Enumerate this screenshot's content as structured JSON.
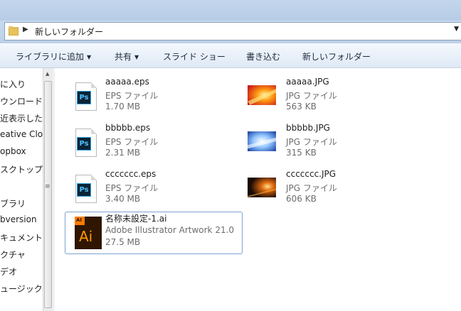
{
  "address": {
    "crumb": "新しいフォルダー"
  },
  "toolbar": {
    "library": "ライブラリに追加",
    "share": "共有",
    "slideshow": "スライド ショー",
    "burn": "書き込む",
    "new_folder": "新しいフォルダー"
  },
  "nav": {
    "items": [
      "に入り",
      "ウンロード",
      "近表示した",
      "eative Clo",
      "opbox",
      "スクトップ",
      "ブラリ",
      "bversion",
      "キュメント",
      "クチャ",
      "デオ",
      "ュージック"
    ]
  },
  "files": [
    {
      "name": "aaaaa.eps",
      "type": "EPS ファイル",
      "size": "1.70 MB",
      "icon": "photoshop-eps-icon",
      "badge": "Ps"
    },
    {
      "name": "aaaaa.JPG",
      "type": "JPG ファイル",
      "size": "563 KB",
      "icon": "jpg-thumbnail"
    },
    {
      "name": "bbbbb.eps",
      "type": "EPS ファイル",
      "size": "2.31 MB",
      "icon": "photoshop-eps-icon",
      "badge": "Ps"
    },
    {
      "name": "bbbbb.JPG",
      "type": "JPG ファイル",
      "size": "315 KB",
      "icon": "jpg-thumbnail"
    },
    {
      "name": "ccccccc.eps",
      "type": "EPS ファイル",
      "size": "3.40 MB",
      "icon": "photoshop-eps-icon",
      "badge": "Ps"
    },
    {
      "name": "ccccccc.JPG",
      "type": "JPG ファイル",
      "size": "606 KB",
      "icon": "jpg-thumbnail"
    },
    {
      "name": "名称未設定-1.ai",
      "type": "Adobe Illustrator Artwork 21.0",
      "size": "27.5 MB",
      "icon": "illustrator-ai-icon",
      "badge": "Ai",
      "badge_small": "AI"
    }
  ],
  "colors": {
    "selection_border": "#7da2ce",
    "ps_badge": "#0a2436",
    "ai_orange": "#ff7c00"
  }
}
